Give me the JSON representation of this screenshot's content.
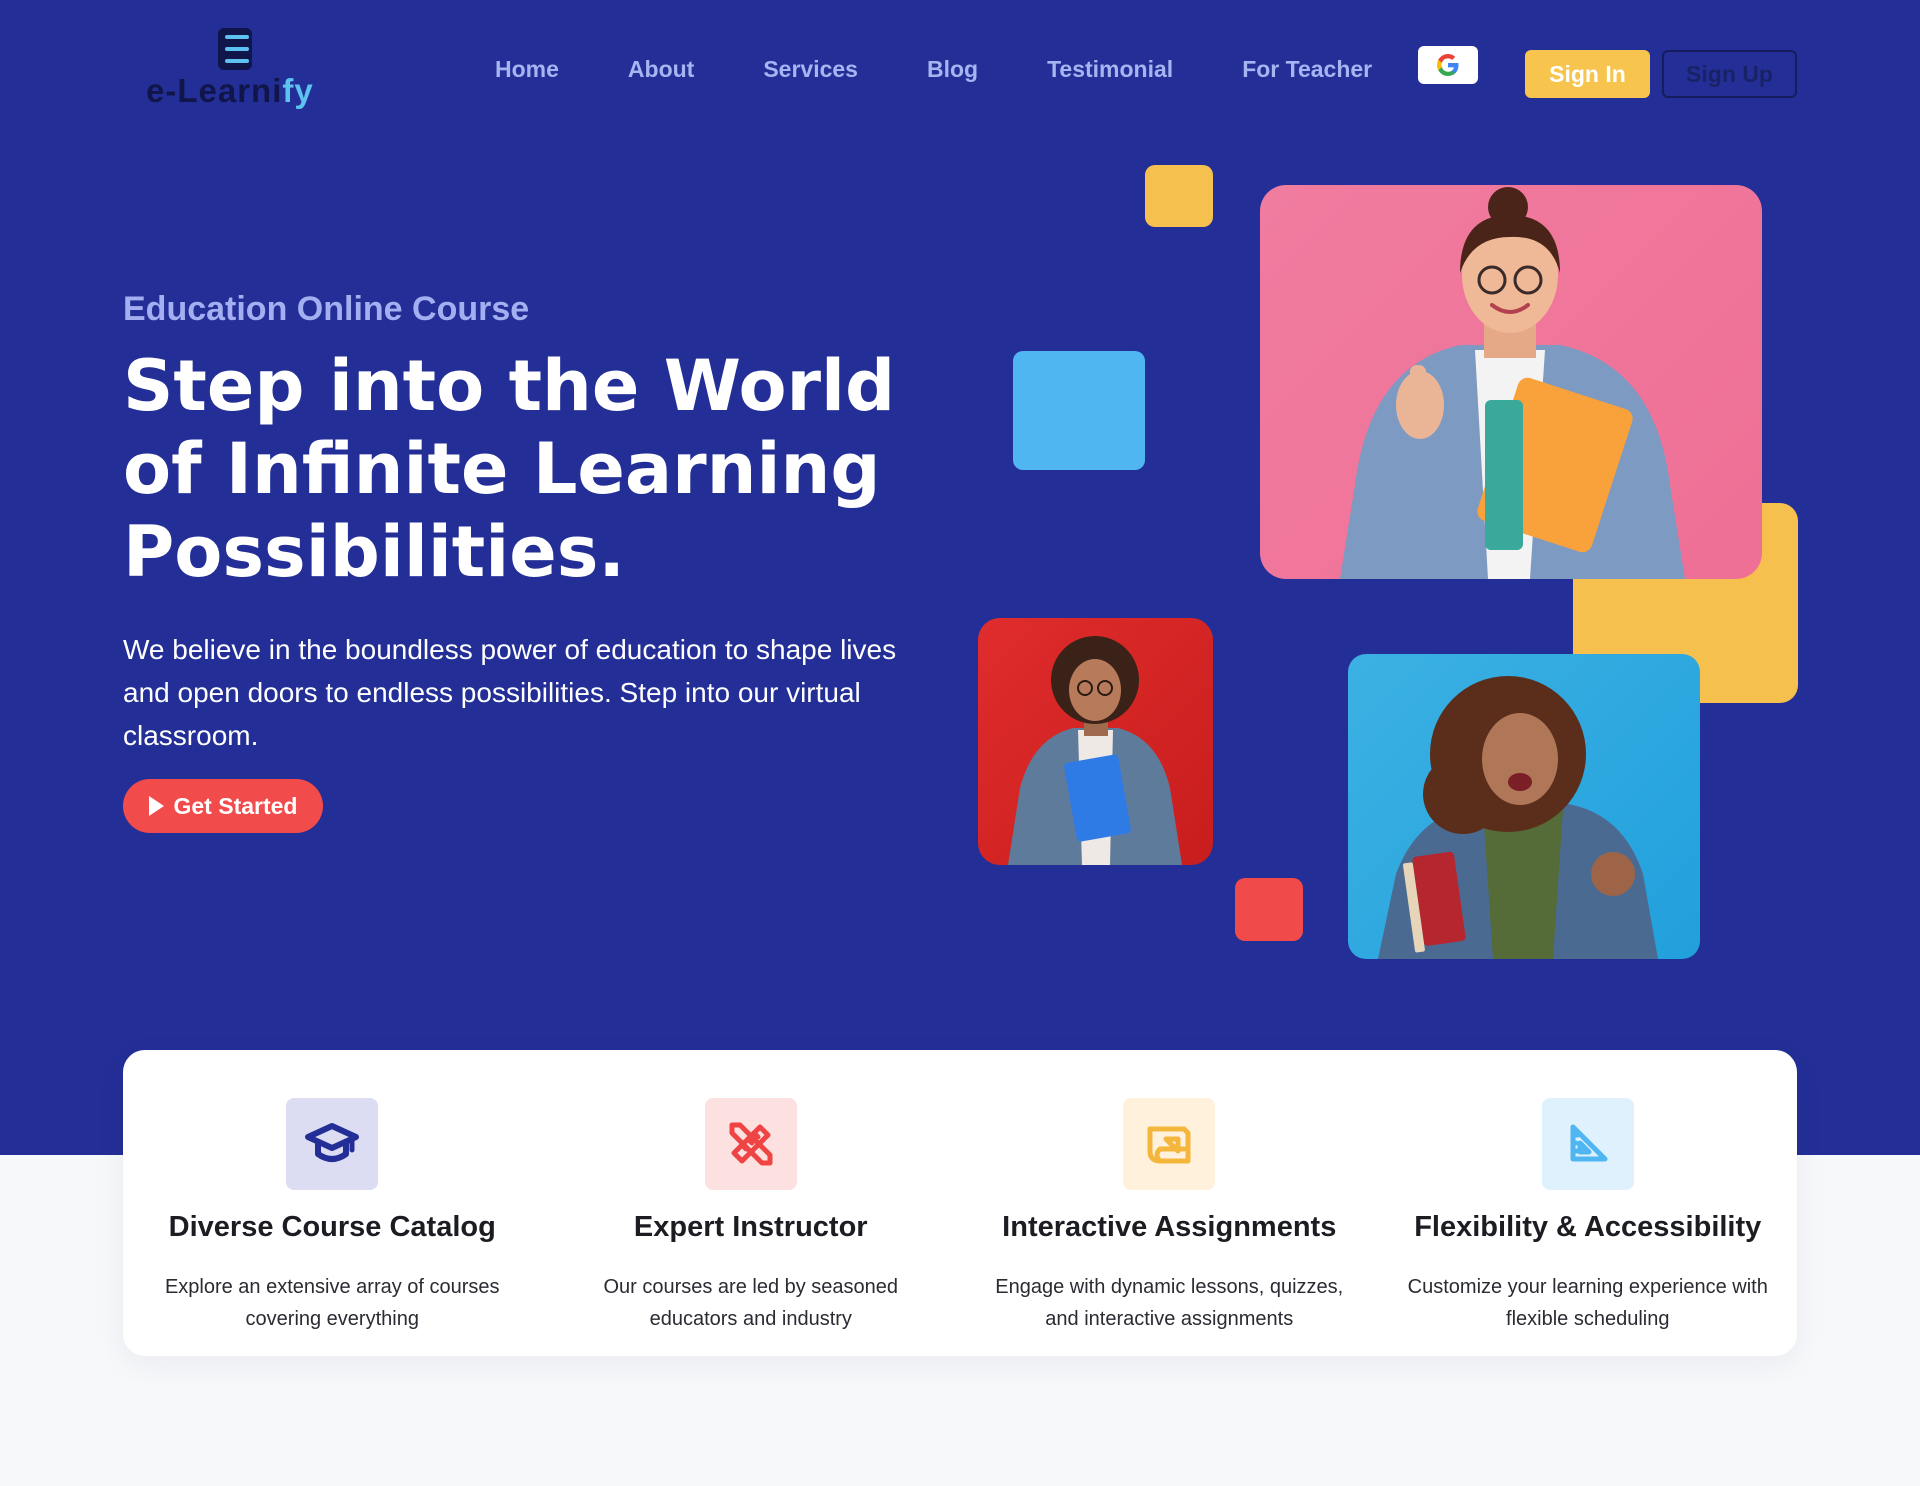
{
  "brand": {
    "name_main": "e-Learni",
    "name_accent": "fy",
    "accent_color": "#5ec2f0",
    "hero_bg": "#232f96"
  },
  "nav": {
    "items": [
      "Home",
      "About",
      "Services",
      "Blog",
      "Testimonial",
      "For Teacher"
    ]
  },
  "auth": {
    "google_icon": "google-g-icon",
    "signin_label": "Sign In",
    "signup_label": "Sign Up"
  },
  "hero": {
    "eyebrow": "Education Online Course",
    "headline": [
      "Step into the World",
      "of Infinite Learning",
      "Possibilities."
    ],
    "lead": "We believe in the boundless power of education to shape lives and open doors to endless possibilities. Step into our virtual classroom.",
    "cta_label": "Get Started",
    "cta_icon": "play-icon"
  },
  "features": [
    {
      "icon": "graduation-cap-icon",
      "title": "Diverse Course Catalog",
      "desc": "Explore an extensive array of courses covering everything"
    },
    {
      "icon": "ruler-pencil-icon",
      "title": "Expert Instructor",
      "desc": "Our courses are led by seasoned educators and industry"
    },
    {
      "icon": "blueprint-icon",
      "title": "Interactive Assignments",
      "desc": "Engage with dynamic lessons, quizzes, and interactive assignments"
    },
    {
      "icon": "set-square-icon",
      "title": "Flexibility & Accessibility",
      "desc": "Customize your learning experience with flexible scheduling"
    }
  ]
}
